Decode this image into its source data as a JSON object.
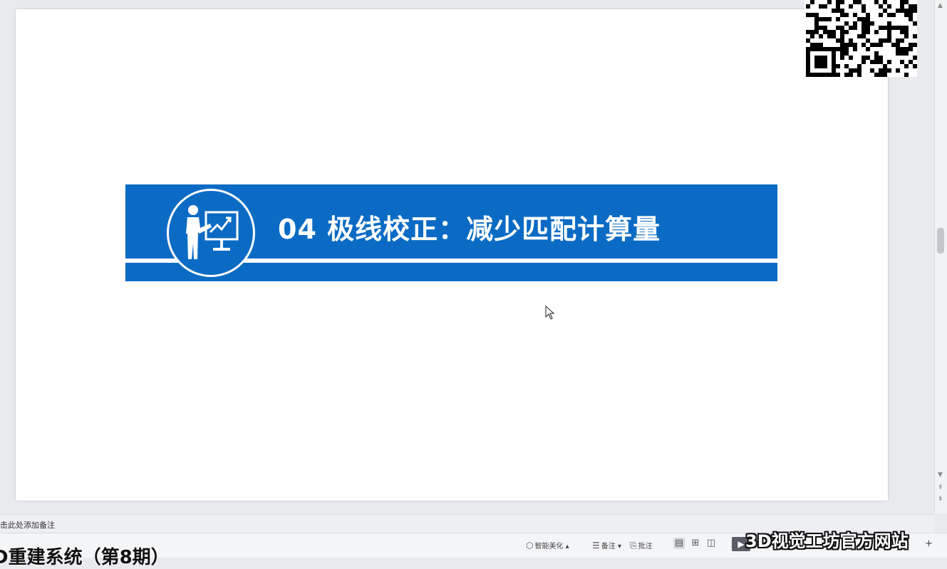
{
  "slide": {
    "title": "04 极线校正：减少匹配计算量",
    "banner_color": "#0b6bc4"
  },
  "qr_code": {
    "kind": "qr-code"
  },
  "notes": {
    "placeholder": "击此处添加备注"
  },
  "status_bar": {
    "smart_beautify": "智能美化",
    "notes_btn": "备注",
    "comments_btn": "批注"
  },
  "overlays": {
    "subtitle": "D重建系统（第8期）",
    "watermark": "3D视觉工坊官方网站"
  }
}
